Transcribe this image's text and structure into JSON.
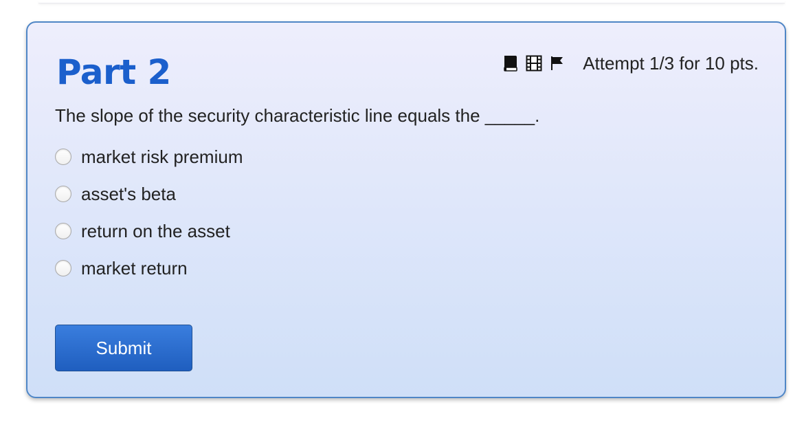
{
  "part": {
    "title": "Part 2"
  },
  "toolbar": {
    "icons": [
      "book-icon",
      "film-icon",
      "flag-icon"
    ],
    "attempt": "Attempt 1/3 for 10 pts."
  },
  "question": {
    "text": "The slope of the security characteristic line equals the _____.",
    "options": [
      {
        "label": "market risk premium",
        "selected": false
      },
      {
        "label": "asset's beta",
        "selected": false
      },
      {
        "label": "return on the asset",
        "selected": false
      },
      {
        "label": "market return",
        "selected": false
      }
    ]
  },
  "submit": {
    "label": "Submit"
  },
  "colors": {
    "title": "#1b5fcc",
    "card_border": "#4f86c6",
    "button": "#2a6cd0"
  }
}
